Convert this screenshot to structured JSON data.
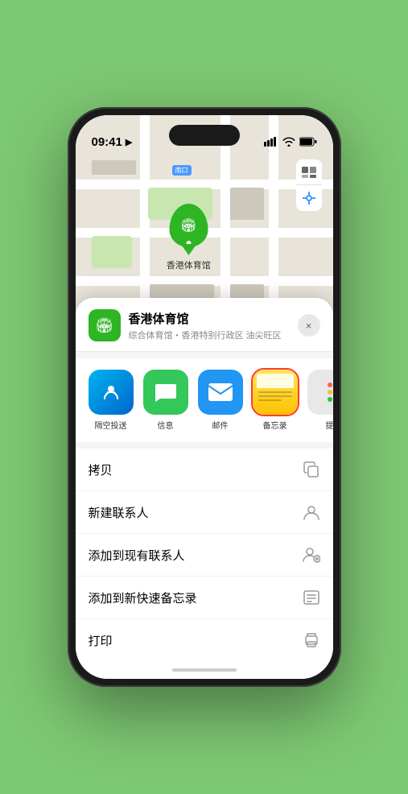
{
  "status_bar": {
    "time": "09:41",
    "location_indicator": "▶"
  },
  "map": {
    "label": "南口",
    "pin_label": "香港体育馆"
  },
  "location_card": {
    "name": "香港体育馆",
    "subtitle": "综合体育馆・香港特别行政区 油尖旺区",
    "close_label": "×"
  },
  "share_items": [
    {
      "id": "airdrop",
      "label": "隔空投送",
      "selected": false
    },
    {
      "id": "messages",
      "label": "信息",
      "selected": false
    },
    {
      "id": "mail",
      "label": "邮件",
      "selected": false
    },
    {
      "id": "notes",
      "label": "备忘录",
      "selected": true
    },
    {
      "id": "more",
      "label": "提",
      "selected": false
    }
  ],
  "actions": [
    {
      "id": "copy",
      "label": "拷贝",
      "icon": "📋"
    },
    {
      "id": "new-contact",
      "label": "新建联系人",
      "icon": "👤"
    },
    {
      "id": "add-existing",
      "label": "添加到现有联系人",
      "icon": "👥"
    },
    {
      "id": "quick-note",
      "label": "添加到新快速备忘录",
      "icon": "📝"
    },
    {
      "id": "print",
      "label": "打印",
      "icon": "🖨"
    }
  ]
}
